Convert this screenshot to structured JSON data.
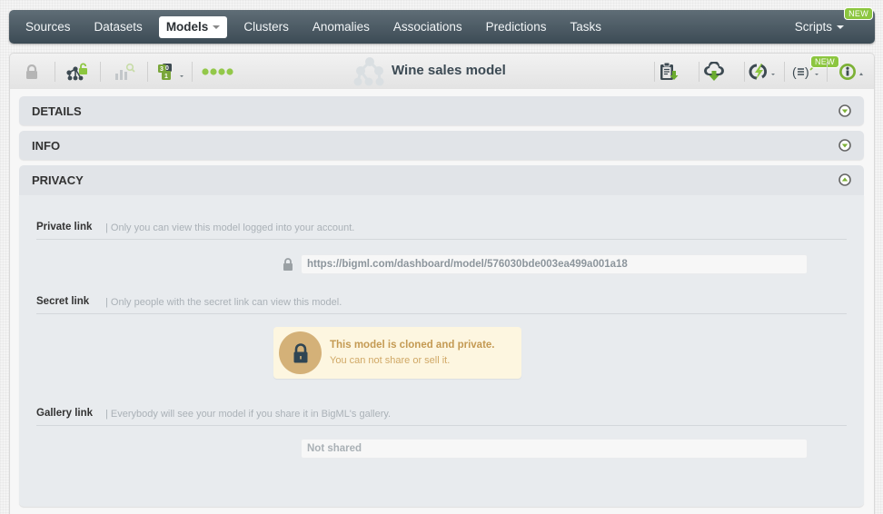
{
  "nav": {
    "items": [
      {
        "label": "Sources"
      },
      {
        "label": "Datasets"
      },
      {
        "label": "Models",
        "active": true
      },
      {
        "label": "Clusters"
      },
      {
        "label": "Anomalies"
      },
      {
        "label": "Associations"
      },
      {
        "label": "Predictions"
      },
      {
        "label": "Tasks"
      }
    ],
    "scripts_label": "Scripts",
    "scripts_badge": "NEW"
  },
  "toolbar": {
    "title": "Wine sales model",
    "icons": [
      "lock-icon",
      "tree-unlock-icon",
      "bar-chart-search-icon",
      "batch-numbers-icon",
      "progress-dots-icon",
      "clipboard-download-icon",
      "cloud-download-icon",
      "lightning-cycle-icon",
      "script-icon",
      "info-icon"
    ],
    "script_badge": "NEW"
  },
  "sections": {
    "details": {
      "title": "DETAILS",
      "state": "collapsed"
    },
    "info": {
      "title": "INFO",
      "state": "collapsed"
    },
    "privacy": {
      "title": "PRIVACY",
      "state": "expanded"
    }
  },
  "privacy": {
    "private_link": {
      "label": "Private link",
      "desc": "| Only you can view this model logged into your account.",
      "url": "https://bigml.com/dashboard/model/576030bde003ea499a001a18"
    },
    "secret_link": {
      "label": "Secret link",
      "desc": "| Only people with the secret link can view this model.",
      "warning_title": "This model is cloned and private.",
      "warning_sub": "You can not share or sell it."
    },
    "gallery_link": {
      "label": "Gallery link",
      "desc": "| Everybody will see your model if you share it in BigML's gallery.",
      "value": "Not shared"
    }
  },
  "colors": {
    "accent_green": "#8cc63f",
    "nav_dark": "#3c4b55",
    "warning_gold": "#c49a53"
  }
}
